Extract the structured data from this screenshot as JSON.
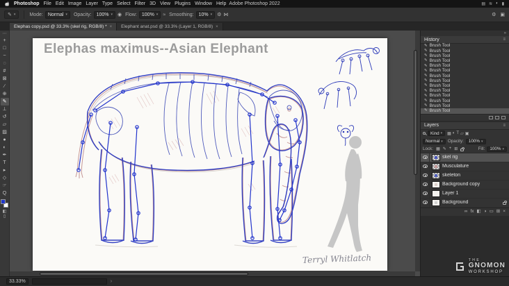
{
  "menubar": {
    "app_name": "Photoshop",
    "menus": [
      "File",
      "Edit",
      "Image",
      "Layer",
      "Type",
      "Select",
      "Filter",
      "3D",
      "View",
      "Plugins",
      "Window",
      "Help"
    ],
    "window_title": "Adobe Photoshop 2022",
    "status_icons": [
      {
        "name": "display-icon",
        "glyph": "▤"
      },
      {
        "name": "wifi-icon",
        "glyph": "≋"
      },
      {
        "name": "control-center-icon",
        "glyph": "◐"
      },
      {
        "name": "battery-icon",
        "glyph": "▮"
      }
    ]
  },
  "options_bar": {
    "mode_label": "Mode:",
    "mode_value": "Normal",
    "opacity_label": "Opacity:",
    "opacity_value": "100%",
    "flow_label": "Flow:",
    "flow_value": "100%",
    "smoothing_label": "Smoothing:",
    "smoothing_value": "10%",
    "right_icons": [
      {
        "name": "brush-settings-icon",
        "glyph": "⚙"
      },
      {
        "name": "panels-toggle-icon",
        "glyph": "▣"
      }
    ]
  },
  "tabs": [
    {
      "label": "Elephas copy.psd @ 33.3% (skel rig, RGB/8) *",
      "active": true
    },
    {
      "label": "Elephant anat.psd @ 33.3% (Layer 1, RGB/8)",
      "active": false
    }
  ],
  "toolbar": {
    "more_icon": "⋯",
    "active_index": 8,
    "tools": [
      {
        "name": "move-tool",
        "glyph": "+"
      },
      {
        "name": "marquee-tool",
        "glyph": "□"
      },
      {
        "name": "lasso-tool",
        "glyph": "~"
      },
      {
        "name": "quick-selection-tool",
        "glyph": "◌"
      },
      {
        "name": "crop-tool",
        "glyph": "#"
      },
      {
        "name": "frame-tool",
        "glyph": "⊠"
      },
      {
        "name": "eyedropper-tool",
        "glyph": "∕"
      },
      {
        "name": "healing-brush-tool",
        "glyph": "⊕"
      },
      {
        "name": "brush-tool",
        "glyph": "✎"
      },
      {
        "name": "clone-stamp-tool",
        "glyph": "⊥"
      },
      {
        "name": "history-brush-tool",
        "glyph": "↺"
      },
      {
        "name": "eraser-tool",
        "glyph": "▱"
      },
      {
        "name": "gradient-tool",
        "glyph": "▨"
      },
      {
        "name": "blur-tool",
        "glyph": "●"
      },
      {
        "name": "dodge-tool",
        "glyph": "◐"
      },
      {
        "name": "pen-tool",
        "glyph": "✒"
      },
      {
        "name": "type-tool",
        "glyph": "T"
      },
      {
        "name": "path-selection-tool",
        "glyph": "▸"
      },
      {
        "name": "shape-tool",
        "glyph": "◇"
      },
      {
        "name": "hand-tool",
        "glyph": "☞"
      },
      {
        "name": "zoom-tool",
        "glyph": "Q"
      }
    ],
    "colors": {
      "foreground": "#2036c8",
      "background": "#ffffff"
    },
    "bottom_icons": [
      {
        "name": "quick-mask-icon",
        "glyph": "◧"
      },
      {
        "name": "screen-mode-icon",
        "glyph": "▯"
      }
    ]
  },
  "canvas": {
    "title": "Elephas maximus--Asian Elephant",
    "signature": "Terryl Whitlatch"
  },
  "history_panel": {
    "title": "History",
    "selected_index": 13,
    "items": [
      "Brush Tool",
      "Brush Tool",
      "Brush Tool",
      "Brush Tool",
      "Brush Tool",
      "Brush Tool",
      "Brush Tool",
      "Brush Tool",
      "Brush Tool",
      "Brush Tool",
      "Brush Tool",
      "Brush Tool",
      "Brush Tool",
      "Brush Tool"
    ]
  },
  "layers_panel": {
    "title": "Layers",
    "filter_label": "Kind",
    "filter_icons": [
      {
        "name": "filter-pixel-layers-icon",
        "glyph": "▦"
      },
      {
        "name": "filter-adjustment-layers-icon",
        "glyph": "◐"
      },
      {
        "name": "filter-type-layers-icon",
        "glyph": "T"
      },
      {
        "name": "filter-shape-layers-icon",
        "glyph": "▱"
      },
      {
        "name": "filter-smart-objects-icon",
        "glyph": "▣"
      }
    ],
    "blend_mode": "Normal",
    "opacity_label": "Opacity:",
    "opacity_value": "100%",
    "lock_label": "Lock:",
    "lock_icons": [
      {
        "name": "lock-transparency-icon",
        "glyph": "▦"
      },
      {
        "name": "lock-paint-icon",
        "glyph": "✎"
      },
      {
        "name": "lock-position-icon",
        "glyph": "+"
      },
      {
        "name": "lock-artboard-icon",
        "glyph": "⊞"
      }
    ],
    "fill_label": "Fill:",
    "fill_value": "100%",
    "layers": [
      {
        "name": "skel rig",
        "selected": true,
        "thumb": "checker",
        "tint": "#2d3fc0",
        "locked": false
      },
      {
        "name": "Musculature",
        "selected": false,
        "thumb": "checker",
        "tint": "#c89090",
        "locked": false
      },
      {
        "name": "skeleton",
        "selected": false,
        "thumb": "checker",
        "tint": "#3548c0",
        "locked": false
      },
      {
        "name": "Background copy",
        "selected": false,
        "thumb": "white",
        "tint": "#d8c9c4",
        "locked": false
      },
      {
        "name": "Layer 1",
        "selected": false,
        "thumb": "white",
        "tint": "",
        "locked": false
      },
      {
        "name": "Background",
        "selected": false,
        "thumb": "white",
        "tint": "#c9c9c9",
        "locked": true
      }
    ],
    "footer_icons": [
      {
        "name": "link-layers-icon",
        "glyph": "∞"
      },
      {
        "name": "layer-style-icon",
        "glyph": "fx"
      },
      {
        "name": "layer-mask-icon",
        "glyph": "◧"
      },
      {
        "name": "adjustment-layer-icon",
        "glyph": "◑"
      },
      {
        "name": "new-group-icon",
        "glyph": "▭"
      },
      {
        "name": "new-layer-icon",
        "glyph": "⊞"
      },
      {
        "name": "delete-layer-icon",
        "glyph": "×"
      }
    ]
  },
  "status_bar": {
    "zoom": "33.33%"
  },
  "watermark": {
    "the": "THE",
    "gnomon": "GNOMON",
    "workshop": "WORKSHOP"
  },
  "icons": {
    "chevron_down": "▾",
    "panel_menu": "≡",
    "collapse_panels": "»",
    "status_chevron": "›"
  }
}
